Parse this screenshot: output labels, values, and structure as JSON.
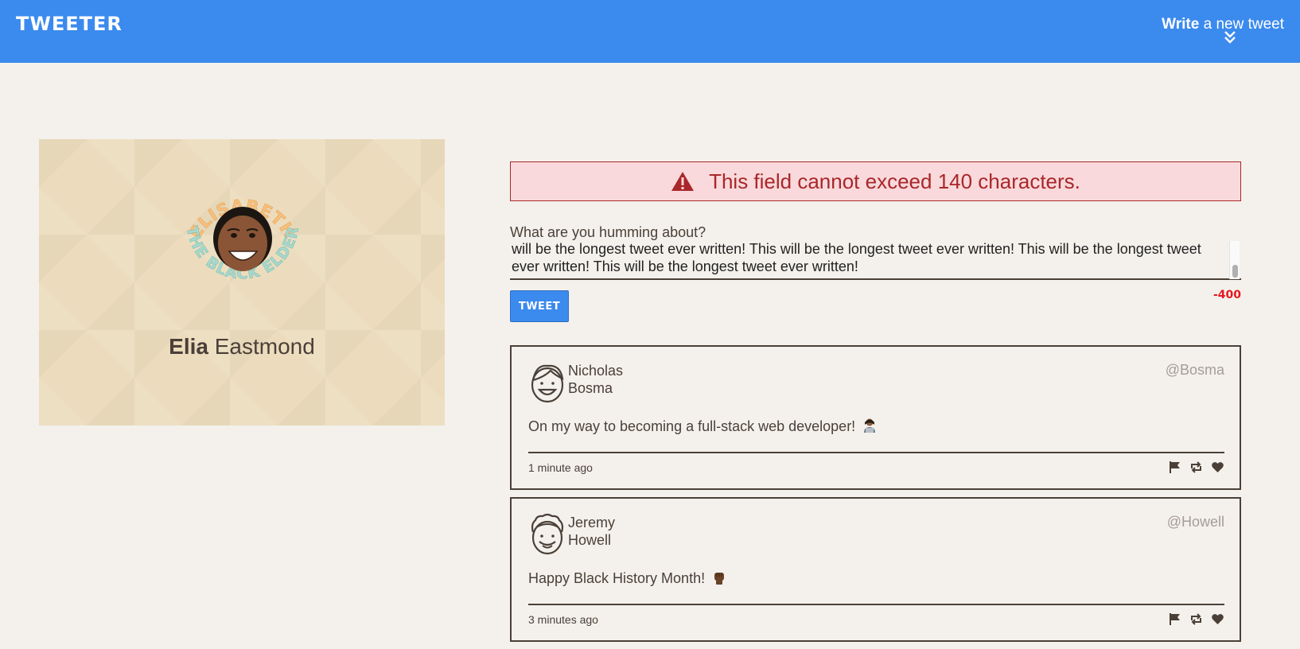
{
  "nav": {
    "brand": "TWEETER",
    "write_bold": "Write",
    "write_rest": "a new tweet",
    "chevron_icon": "double-chevron-down-icon"
  },
  "profile": {
    "badge_top_text": "ELISABETH",
    "badge_bottom_text": "THE BLACK ELDER",
    "first_name": "Elia",
    "last_name": "Eastmond"
  },
  "compose": {
    "error": "This field cannot exceed 140 characters.",
    "error_icon": "warning-triangle-icon",
    "label": "What are you humming about?",
    "text": "will be the longest tweet ever written! This will be the longest tweet ever written! This will be the longest tweet ever written! This will be the longest tweet ever written!",
    "button": "TWEET",
    "counter": "-400"
  },
  "tweets": [
    {
      "first": "Nicholas",
      "last": "Bosma",
      "handle": "@Bosma",
      "content": "On my way to becoming a full-stack web developer!",
      "emoji": "technologist",
      "time": "1 minute ago"
    },
    {
      "first": "Jeremy",
      "last": "Howell",
      "handle": "@Howell",
      "content": "Happy Black History Month!",
      "emoji": "raised-fist-dark",
      "time": "3 minutes ago"
    }
  ],
  "icons": [
    "flag-icon",
    "retweet-icon",
    "heart-icon"
  ],
  "colors": {
    "nav": "#3b8aee",
    "background": "#f4f1ec",
    "error_bg": "#f9d9db",
    "error_text": "#a9272b",
    "counter": "#e5181e"
  }
}
